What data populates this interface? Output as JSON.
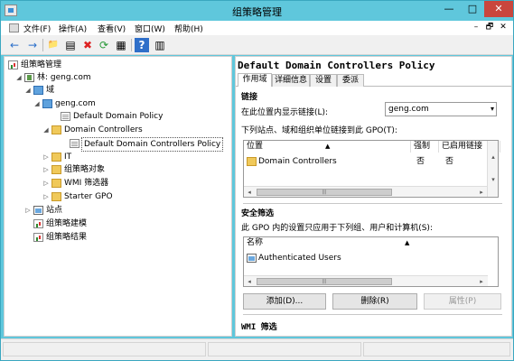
{
  "window": {
    "title": "组策略管理",
    "min": "—",
    "max": "□",
    "close": "✕"
  },
  "menu": {
    "items": [
      "文件(F)",
      "操作(A)",
      "查看(V)",
      "窗口(W)",
      "帮助(H)"
    ],
    "mdi": [
      "–",
      "🗗",
      "✕"
    ]
  },
  "toolbar": {
    "buttons": [
      "←",
      "→",
      "📁",
      "▤",
      "✖",
      "⟳",
      "▦",
      "?",
      "▥"
    ]
  },
  "tree": {
    "root": "组策略管理",
    "forest": "林: geng.com",
    "domains": "域",
    "domain": "geng.com",
    "policy": "Default Domain Policy",
    "ou": "Domain Controllers",
    "ou_policy": "Default Domain Controllers Policy",
    "it": "IT",
    "gpo_objects": "组策略对象",
    "wmi": "WMI 筛选器",
    "starter": "Starter GPO",
    "sites": "站点",
    "modeling": "组策略建模",
    "results": "组策略结果"
  },
  "right": {
    "title": "Default Domain Controllers Policy",
    "tabs": [
      "作用域",
      "详细信息",
      "设置",
      "委派"
    ],
    "links_heading": "链接",
    "show_links_label": "在此位置内显示链接(L):",
    "location_value": "geng.com",
    "linked_label": "下列站点、域和组织单位链接到此 GPO(T):",
    "links_columns": [
      "位置",
      "强制",
      "已启用链接"
    ],
    "links_rows": [
      {
        "location": "Domain Controllers",
        "enforced": "否",
        "enabled": "否"
      }
    ],
    "security_heading": "安全筛选",
    "security_desc": "此 GPO 内的设置只应用于下列组、用户和计算机(S):",
    "security_column": "名称",
    "security_rows": [
      "Authenticated Users"
    ],
    "add_button": "添加(D)...",
    "remove_button": "删除(R)",
    "properties_button": "属性(P)",
    "wmi_heading": "WMI 筛选"
  }
}
